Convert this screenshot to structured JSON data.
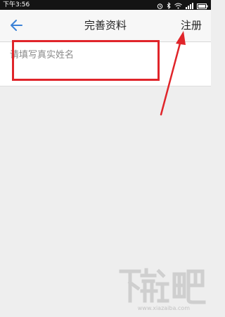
{
  "status_bar": {
    "time": "下午3:56",
    "icons": [
      "alarm-icon",
      "wifi-icon",
      "signal-icon",
      "battery-icon"
    ]
  },
  "header": {
    "back_icon": "arrow-left-icon",
    "title": "完善资料",
    "register_label": "注册"
  },
  "form": {
    "name_placeholder": "请填写真实姓名",
    "name_value": ""
  },
  "annotation": {
    "color": "#e0252a"
  },
  "watermark": {
    "brand": "下载吧",
    "url": "www.xiazaiba.com"
  },
  "colors": {
    "accent": "#3b82d6",
    "background": "#eeeeee"
  }
}
